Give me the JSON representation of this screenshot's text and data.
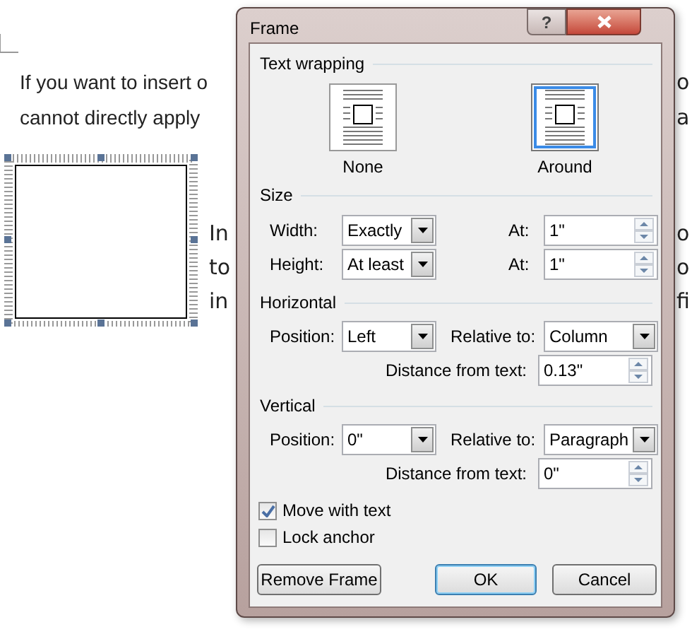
{
  "document": {
    "left_lines": [
      "If you want to insert o",
      "cannot directly apply"
    ],
    "side_lines": [
      "In",
      "to",
      "in"
    ],
    "right_fragments": [
      "o",
      "a",
      "o",
      "o",
      "fi"
    ]
  },
  "dialog": {
    "title": "Frame",
    "help_button": "?",
    "text_wrapping": {
      "title": "Text wrapping",
      "options": [
        {
          "label": "None",
          "selected": false
        },
        {
          "label": "Around",
          "selected": true
        }
      ]
    },
    "size": {
      "title": "Size",
      "rows": [
        {
          "label": "Width:",
          "mode": "Exactly",
          "at_label": "At:",
          "at": "1\""
        },
        {
          "label": "Height:",
          "mode": "At least",
          "at_label": "At:",
          "at": "1\""
        }
      ]
    },
    "positions": [
      {
        "title": "Horizontal",
        "position_label": "Position:",
        "position": "Left",
        "relative_label": "Relative to:",
        "relative": "Column",
        "distance_label": "Distance from text:",
        "distance": "0.13\""
      },
      {
        "title": "Vertical",
        "position_label": "Position:",
        "position": "0\"",
        "relative_label": "Relative to:",
        "relative": "Paragraph",
        "distance_label": "Distance from text:",
        "distance": "0\""
      }
    ],
    "checkboxes": [
      {
        "label": "Move with text",
        "checked": true
      },
      {
        "label": "Lock anchor",
        "checked": false
      }
    ],
    "buttons": [
      {
        "label": "Remove Frame",
        "default": false
      },
      {
        "label": "OK",
        "default": true
      },
      {
        "label": "Cancel",
        "default": false
      }
    ]
  }
}
